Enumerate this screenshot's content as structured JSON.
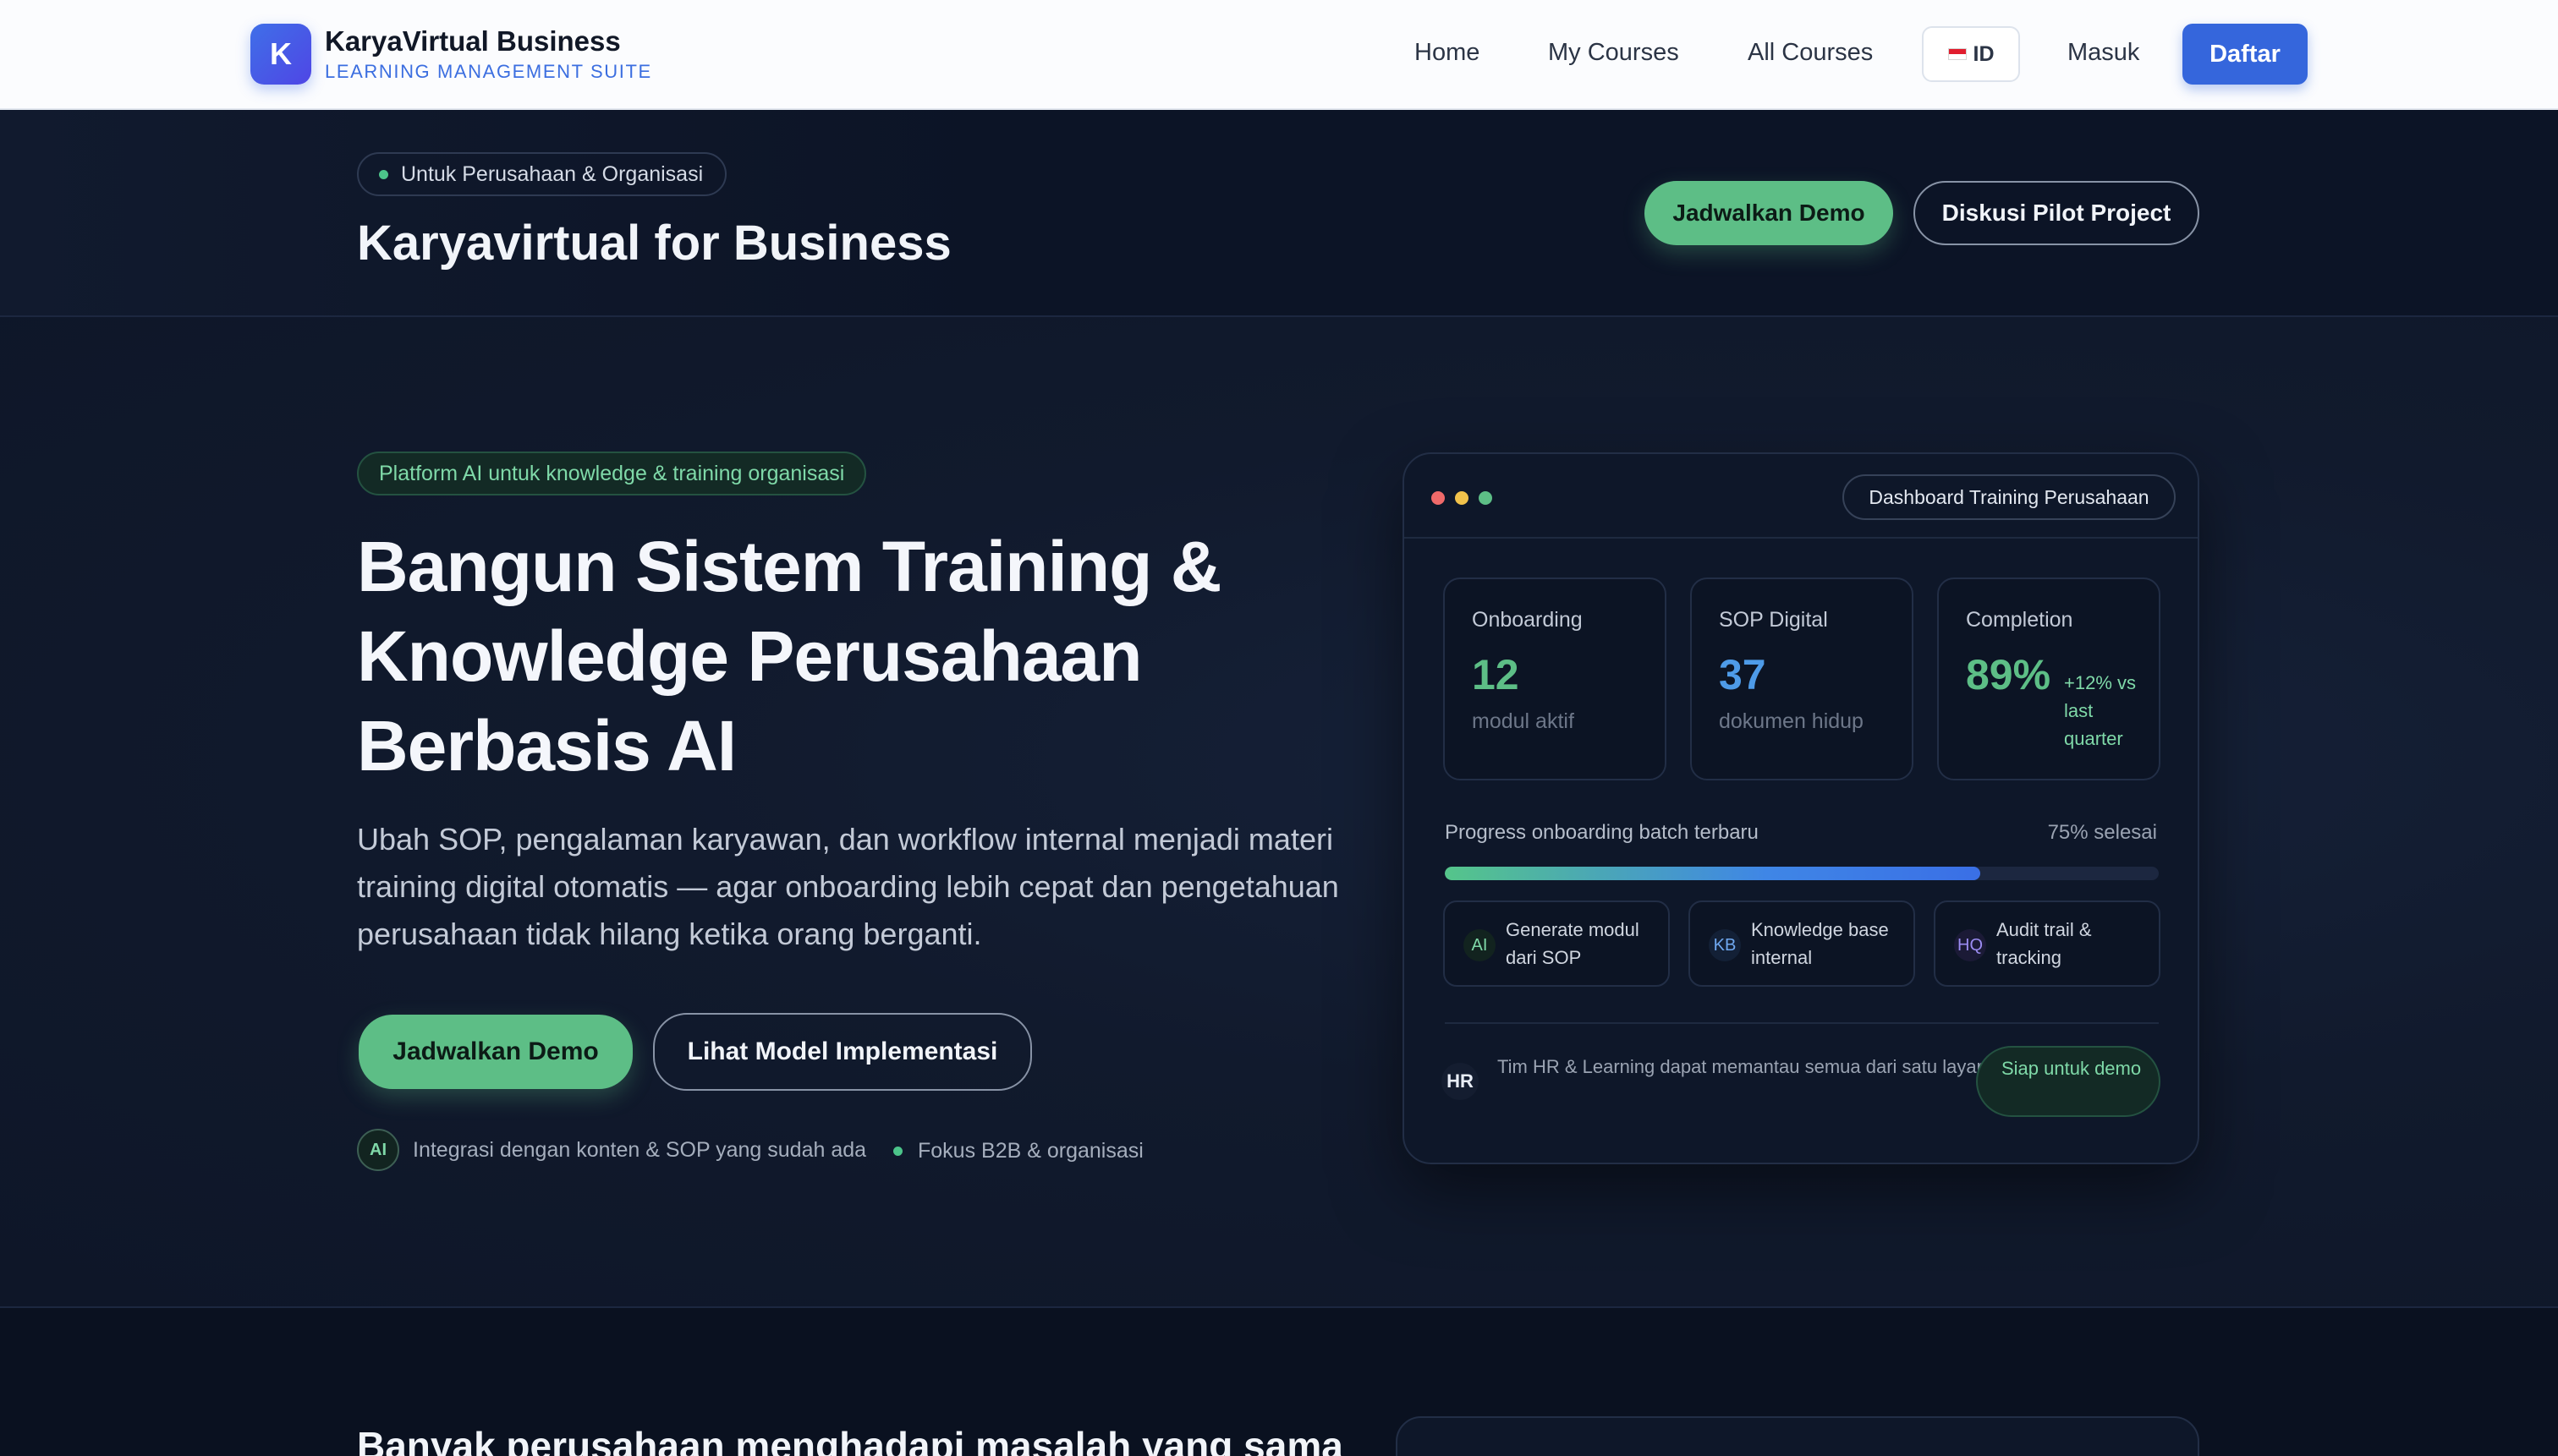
{
  "navbar": {
    "logo_letter": "K",
    "brand_name": "KaryaVirtual Business",
    "brand_tagline": "LEARNING MANAGEMENT SUITE",
    "links": [
      "Home",
      "My Courses",
      "All Courses"
    ],
    "lang_label": "ID",
    "login_label": "Masuk",
    "signup_label": "Daftar"
  },
  "biz_header": {
    "badge": "Untuk Perusahaan & Organisasi",
    "title": "Karyavirtual for Business",
    "primary_cta": "Jadwalkan Demo",
    "secondary_cta": "Diskusi Pilot Project"
  },
  "hero": {
    "badge": "Platform AI untuk knowledge & training organisasi",
    "title_lines": [
      "Bangun Sistem Training &",
      "Knowledge Perusahaan",
      "Berbasis AI"
    ],
    "description": "Ubah SOP, pengalaman karyawan, dan workflow internal menjadi materi training digital otomatis — agar onboarding lebih cepat dan pengetahuan perusahaan tidak hilang ketika orang berganti.",
    "primary_cta": "Jadwalkan Demo",
    "secondary_cta": "Lihat Model Implementasi",
    "features": [
      {
        "chip": "AI",
        "text": "Integrasi dengan konten & SOP yang sudah ada"
      },
      {
        "text": "Fokus B2B & organisasi"
      }
    ]
  },
  "dashboard": {
    "label": "Dashboard Training Perusahaan",
    "stats": [
      {
        "label": "Onboarding",
        "value": "12",
        "sub": "modul aktif",
        "color": "#5dbe86"
      },
      {
        "label": "SOP Digital",
        "value": "37",
        "sub": "dokumen hidup",
        "color": "#4e9be8"
      },
      {
        "label": "Completion",
        "value": "89%",
        "delta": "+12% vs last quarter",
        "color": "#5dbe86"
      }
    ],
    "progress": {
      "label": "Progress onboarding batch terbaru",
      "pct_text": "75% selesai",
      "value": 75
    },
    "features": [
      {
        "chip": "AI",
        "text": "Generate modul dari SOP",
        "color": "#7fd9a8",
        "bg": "#12231f"
      },
      {
        "chip": "KB",
        "text": "Knowledge base internal",
        "color": "#6fa8f0",
        "bg": "#132036"
      },
      {
        "chip": "HQ",
        "text": "Audit trail & tracking",
        "color": "#9b8cf2",
        "bg": "#1b1a36"
      }
    ],
    "footer": {
      "chip": "HR",
      "text": "Tim HR & Learning dapat memantau semua dari satu layar.",
      "status": "Siap untuk demo"
    }
  },
  "next_section": {
    "title": "Banyak perusahaan menghadapi masalah yang sama"
  },
  "colors": {
    "accent_green": "#5dbe86",
    "accent_blue": "#3566dc",
    "bg_dark": "#0e1628"
  }
}
